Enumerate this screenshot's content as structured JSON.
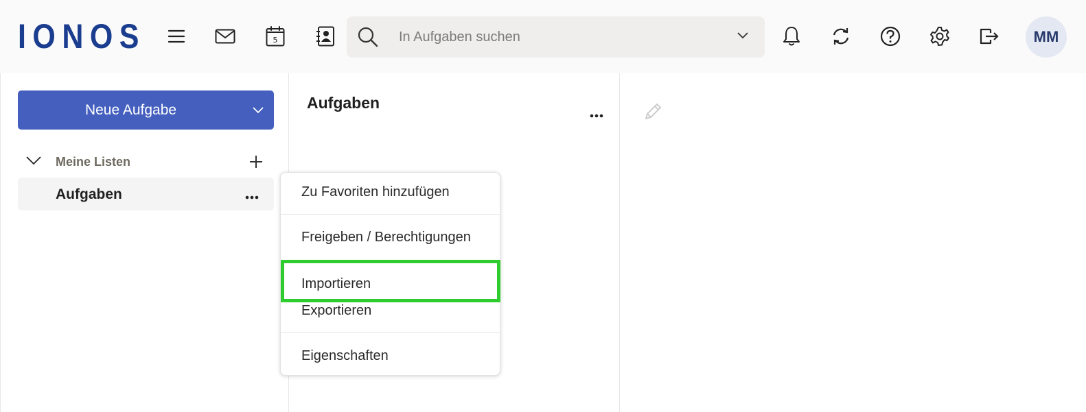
{
  "header": {
    "logo": "IONOS",
    "search_placeholder": "In Aufgaben suchen",
    "avatar_initials": "MM",
    "icons": [
      "menu-icon",
      "mail-icon",
      "calendar-icon",
      "contacts-icon",
      "bell-icon",
      "sync-icon",
      "help-icon",
      "gear-icon",
      "logout-icon"
    ],
    "calendar_day": "5"
  },
  "sidebar": {
    "new_button_label": "Neue Aufgabe",
    "lists_title": "Meine Listen",
    "items": [
      {
        "label": "Aufgaben"
      }
    ]
  },
  "main": {
    "heading": "Aufgaben"
  },
  "context_menu": {
    "items": [
      {
        "label": "Zu Favoriten hinzufügen"
      },
      {
        "label": "Freigeben / Berechtigungen"
      },
      {
        "label": "Importieren"
      },
      {
        "label": "Exportieren"
      },
      {
        "label": "Eigenschaften"
      }
    ],
    "highlighted_item": "Importieren"
  },
  "colors": {
    "brand": "#1b3d8f",
    "primary_button": "#445fbe",
    "highlight": "#2ecc2e"
  }
}
